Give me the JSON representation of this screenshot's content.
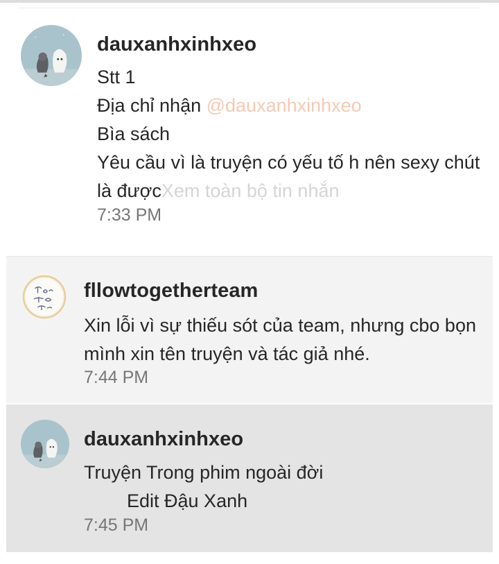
{
  "messages": [
    {
      "username": "dauxanhxinhxeo",
      "lines": {
        "line1": "Stt 1",
        "line2_prefix": "Địa chỉ nhận ",
        "line2_mention": "@dauxanhxinhxeo",
        "line3": "Bìa sách",
        "line4": "Yêu cầu vì là truyện có yếu tố h nên sexy chút",
        "line5": "là được",
        "see_more": "Xem toàn bộ tin nhắn"
      },
      "time": "7:33 PM",
      "avatar_icon": "avatar-dauxanhxinhxeo-icon"
    },
    {
      "username": "fllowtogetherteam",
      "lines": {
        "line1": "Xin lỗi vì sự thiếu sót của team, nhưng cbo bọn",
        "line2": "mình xin tên truyện và tác giả nhé."
      },
      "time": "7:44 PM",
      "avatar_icon": "avatar-fllowtogetherteam-icon"
    },
    {
      "username": "dauxanhxinhxeo",
      "lines": {
        "line1": "Truyện Trong phim ngoài đời",
        "line2": "Edit Đậu Xanh"
      },
      "time": "7:45 PM",
      "avatar_icon": "avatar-dauxanhxinhxeo-icon"
    }
  ],
  "colors": {
    "text": "#262626",
    "timestamp": "#767676",
    "mention": "#f5c9b3",
    "see_more": "#d5d5d5",
    "row2_bg": "#f3f3f3",
    "row3_bg": "#e4e4e4"
  }
}
